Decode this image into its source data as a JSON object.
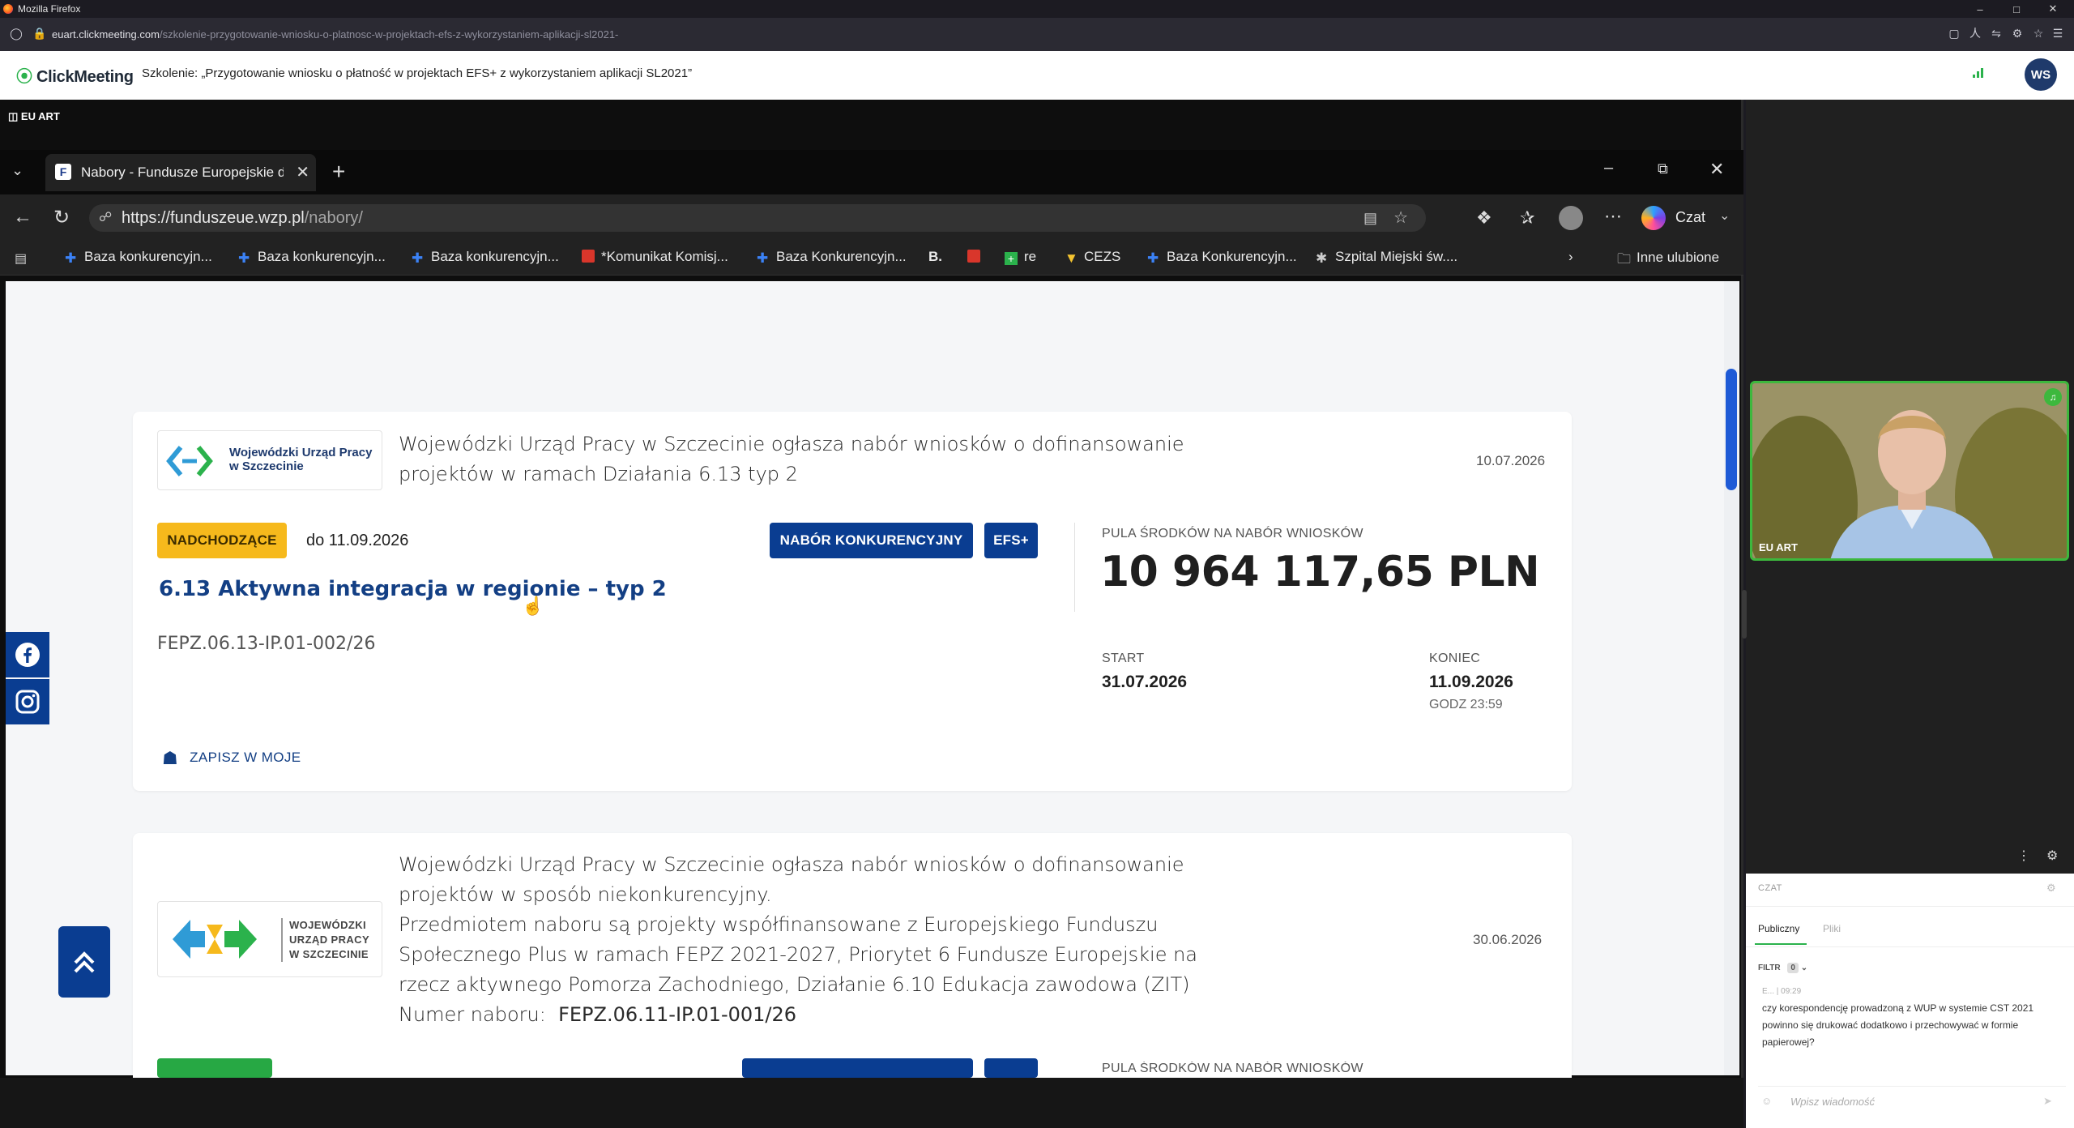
{
  "firefox": {
    "window_title": "Mozilla Firefox",
    "url_host": "euart.clickmeeting.com",
    "url_prefix": "",
    "url_path": "/szkolenie-przygotowanie-wniosku-o-platnosc-w-projektach-efs-z-wykorzystaniem-aplikacji-sl2021-"
  },
  "clickmeeting": {
    "logo": "ClickMeeting",
    "title": "Szkolenie: „Przygotowanie wniosku o płatność w projektach EFS+ z wykorzystaniem aplikacji SL2021”",
    "avatar": "WS",
    "share_label": "EU ART"
  },
  "edge": {
    "tab_title": "Nabory - Fundusze Europejskie dla",
    "url_host": "https://funduszeue.wzp.pl",
    "url_path": "/nabory/",
    "copilot_label": "Czat",
    "bookmarks": [
      "Baza konkurencyjn...",
      "Baza konkurencyjn...",
      "Baza konkurencyjn...",
      "*Komunikat Komisj...",
      "Baza Konkurencyjn...",
      "B.",
      "re",
      "CEZS",
      "Baza Konkurencyjn...",
      "Szpital Miejski św...."
    ],
    "other_favorites": "Inne ulubione"
  },
  "card1": {
    "logo_line1": "Wojewódzki Urząd Pracy",
    "logo_line2": "w Szczecinie",
    "desc_line1": "Wojewódzki Urząd Pracy w Szczecinie ogłasza nabór wniosków o dofinansowanie",
    "desc_line2": "projektów w ramach Działania 6.13 typ 2",
    "date": "10.07.2026",
    "status": "NADCHODZĄCE",
    "deadline": "do 11.09.2026",
    "type_badge": "NABÓR KONKURENCYJNY",
    "fund_badge": "EFS+",
    "title": "6.13 Aktywna integracja w regionie – typ 2",
    "code": "FEPZ.06.13-IP.01-002/26",
    "pool_label": "PULA ŚRODKÓW NA NABÓR WNIOSKÓW",
    "amount": "10 964 117,65 PLN",
    "start_label": "START",
    "start": "31.07.2026",
    "end_label": "KONIEC",
    "end": "11.09.2026",
    "end_time": "GODZ 23:59",
    "save": "ZAPISZ W MOJE"
  },
  "card2": {
    "logo_line1": "WOJEWÓDZKI",
    "logo_line2": "URZĄD PRACY",
    "logo_line3": "W SZCZECINIE",
    "desc_line1": "Wojewódzki Urząd Pracy w Szczecinie ogłasza nabór wniosków o dofinansowanie",
    "desc_line2": "projektów w sposób niekonkurencyjny.",
    "desc_line3": "Przedmiotem naboru są projekty współfinansowane z Europejskiego Funduszu",
    "desc_line4": "Społecznego Plus  w ramach FEPZ 2021-2027, Priorytet 6 Fundusze Europejskie na",
    "desc_line5": "rzecz aktywnego Pomorza Zachodniego, Działanie 6.10  Edukacja zawodowa (ZIT)",
    "desc_num_label": "Numer naboru:",
    "desc_num": "FEPZ.06.11-IP.01-001/26",
    "date": "30.06.2026",
    "pool_label": "PULA ŚRODKÓW NA NABÓR WNIOSKÓW"
  },
  "video": {
    "label": "EU ART"
  },
  "chat": {
    "header": "CZAT",
    "tab_public": "Publiczny",
    "tab_files": "Pliki",
    "filter": "FILTR",
    "filter_count": "0",
    "meta": "E...  |  09:29",
    "message": "czy korespondencję prowadzoną z WUP w systemie CST 2021 powinno się drukować dodatkowo i przechowywać w formie papierowej?",
    "input_placeholder": "Wpisz wiadomość"
  },
  "colors": {
    "brand_blue": "#0a3d91",
    "status_orange": "#f6b91c",
    "status_green": "#27a844",
    "speaking_green": "#3db83d"
  }
}
